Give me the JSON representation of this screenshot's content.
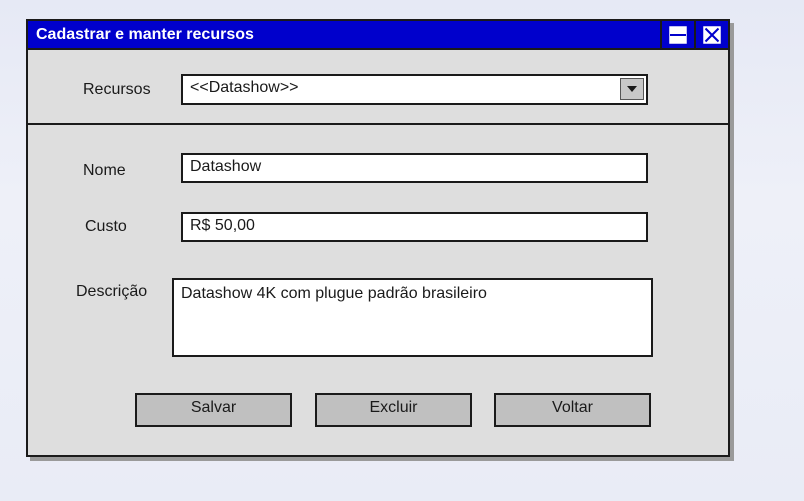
{
  "window": {
    "title": "Cadastrar e manter recursos",
    "maximize_icon": "maximize-icon",
    "close_icon": "close-icon",
    "title_color": "#0000cc"
  },
  "form": {
    "recursos_label": "Recursos",
    "recursos_selected": "<<Datashow>>",
    "nome_label": "Nome",
    "nome_value": "Datashow",
    "custo_label": "Custo",
    "custo_value": "R$ 50,00",
    "descricao_label": "Descrição",
    "descricao_value": "Datashow 4K com plugue padrão brasileiro"
  },
  "buttons": {
    "salvar": "Salvar",
    "excluir": "Excluir",
    "voltar": "Voltar"
  }
}
